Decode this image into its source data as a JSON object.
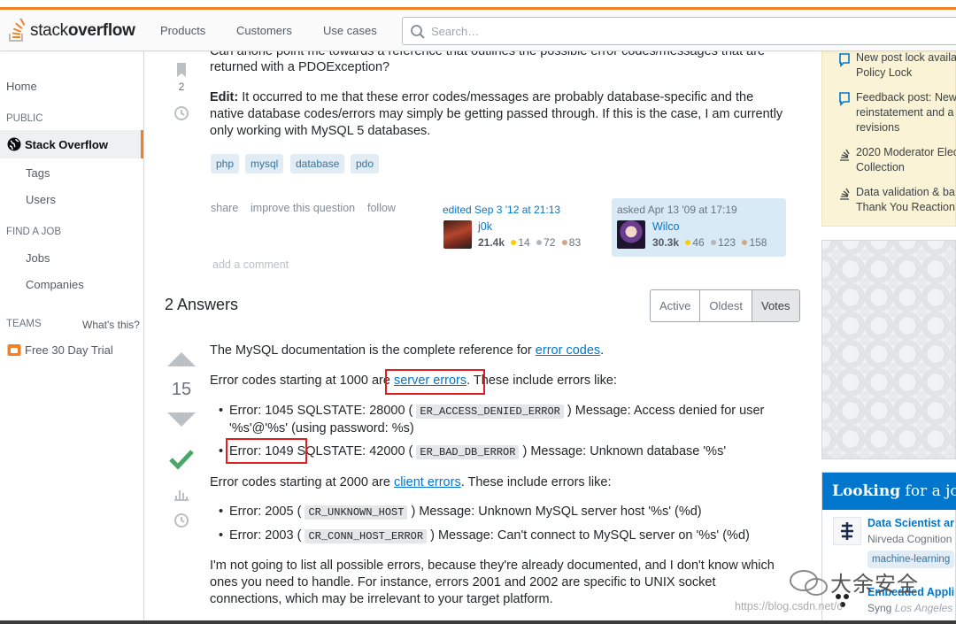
{
  "header": {
    "logo_text_light": "stack",
    "logo_text_bold": "overflow",
    "nav": [
      "Products",
      "Customers",
      "Use cases"
    ],
    "search_placeholder": "Search…"
  },
  "leftnav": {
    "home": "Home",
    "public_heading": "PUBLIC",
    "stack_overflow": "Stack Overflow",
    "tags": "Tags",
    "users": "Users",
    "find_job_heading": "FIND A JOB",
    "jobs": "Jobs",
    "companies": "Companies",
    "teams_heading": "TEAMS",
    "whats_this": "What's this?",
    "free_trial": "Free 30 Day Trial"
  },
  "question": {
    "cut_line": "Can anone point me towards a reference that outlines the possible error codes/messages that are",
    "line2": "returned with a PDOException?",
    "edit_label": "Edit:",
    "edit_text": " It occurred to me that these error codes/messages are probably database-specific and the native database codes/errors may simply be getting passed through. If this is the case, I am currently only working with MySQL 5 databases.",
    "bookmark_count": "2",
    "tags": [
      "php",
      "mysql",
      "database",
      "pdo"
    ],
    "menu": [
      "share",
      "improve this question",
      "follow"
    ],
    "edited": {
      "label": "edited Sep 3 '12 at 21:13",
      "user": "j0k",
      "rep": "21.4k",
      "gold": "14",
      "silver": "72",
      "bronze": "83"
    },
    "asked": {
      "label": "asked Apr 13 '09 at 17:19",
      "user": "Wilco",
      "rep": "30.3k",
      "gold": "46",
      "silver": "123",
      "bronze": "158"
    },
    "add_comment": "add a comment"
  },
  "answers": {
    "title": "2 Answers",
    "sort": [
      "Active",
      "Oldest",
      "Votes"
    ],
    "score": "15",
    "p1_pre": "The MySQL documentation is the complete reference for ",
    "p1_link": "error codes",
    "p1_post": ".",
    "p2_pre": "Error codes starting at 1000 are ",
    "p2_link": "server errors",
    "p2_post": ". These include errors like:",
    "b1_pre": "Error: 1045 SQLSTATE: 28000 (",
    "b1_code": "ER_ACCESS_DENIED_ERROR",
    "b1_post": ") Message: Access denied for user '%s'@'%s' (using password: %s)",
    "b2_pre": "Error: 1049 SQLSTATE: 42000 (",
    "b2_code": "ER_BAD_DB_ERROR",
    "b2_post": ") Message: Unknown database '%s'",
    "p3_pre": "Error codes starting at 2000 are ",
    "p3_link": "client errors",
    "p3_post": ". These include errors like:",
    "b3_pre": "Error: 2005 (",
    "b3_code": "CR_UNKNOWN_HOST",
    "b3_post": ") Message: Unknown MySQL server host '%s' (%d)",
    "b4_pre": "Error: 2003 (",
    "b4_code": "CR_CONN_HOST_ERROR",
    "b4_post": ") Message: Can't connect to MySQL server on '%s' (%d)",
    "p4": "I'm not going to list all possible errors, because they're already documented, and I don't know which ones you need to handle. For instance, errors 2001 and 2002 are specific to UNIX socket connections, which may be irrelevant to your target platform."
  },
  "sidebar": {
    "blog_items": [
      "New post lock availa",
      "Policy Lock",
      "Feedback post: New",
      "reinstatement and a",
      "revisions",
      "2020 Moderator Elec",
      "Collection",
      "Data validation & ba",
      "Thank You Reaction"
    ],
    "jobs_head_bold": "Looking",
    "jobs_head_rest": " for a job",
    "job1_title": "Data Scientist ar",
    "job1_company": "Nirveda Cognition",
    "job1_tag": "machine-learning",
    "job2_title": "Embedded Appli",
    "job2_company": "Syng",
    "job2_location": "Los Angeles"
  },
  "watermark": {
    "cn": "大余安全",
    "url": "https://blog.csdn.net/c"
  },
  "colors": {
    "accent": "#f48024",
    "link": "#0077cc",
    "tag_bg": "#e1ecf4",
    "accepted": "#48a868",
    "highlight_box": "#e02020"
  }
}
